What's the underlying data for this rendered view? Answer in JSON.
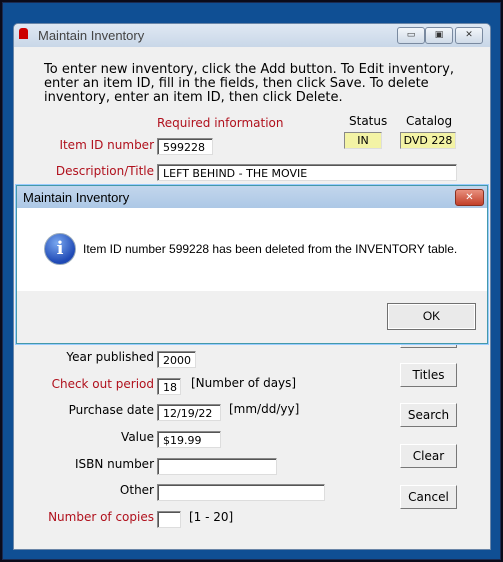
{
  "window": {
    "title": "Maintain Inventory",
    "minimize": "▭",
    "maximize": "▣",
    "close": "✕"
  },
  "instructions": [
    "To enter new inventory, click the Add button.  To Edit inventory,",
    "enter an item ID, fill in the fields, then click Save.  To delete",
    "inventory, enter an item ID, then click Delete."
  ],
  "required_label": "Required information",
  "status": {
    "label": "Status",
    "value": "IN"
  },
  "catalog": {
    "label": "Catalog",
    "value": "DVD 228"
  },
  "fields": {
    "item_id": {
      "label": "Item ID number",
      "value": "599228"
    },
    "description": {
      "label": "Description/Title",
      "value": "LEFT BEHIND - THE MOVIE"
    },
    "year": {
      "label": "Year published",
      "value": "2000"
    },
    "checkout": {
      "label": "Check out period",
      "value": "18",
      "hint": "[Number of days]"
    },
    "purchase_date": {
      "label": "Purchase date",
      "value": "12/19/22",
      "hint": "[mm/dd/yy]"
    },
    "value": {
      "label": "Value",
      "value": "$19.99"
    },
    "isbn": {
      "label": "ISBN number",
      "value": ""
    },
    "other": {
      "label": "Other",
      "value": ""
    },
    "copies": {
      "label": "Number of copies",
      "value": "",
      "hint": "[1 - 20]"
    }
  },
  "buttons": {
    "titles": "Titles",
    "search": "Search",
    "clear": "Clear",
    "cancel": "Cancel"
  },
  "dialog": {
    "title": "Maintain Inventory",
    "message": "Item ID number 599228 has been deleted from the INVENTORY table.",
    "ok": "OK",
    "close": "✕",
    "icon": "info-icon"
  }
}
